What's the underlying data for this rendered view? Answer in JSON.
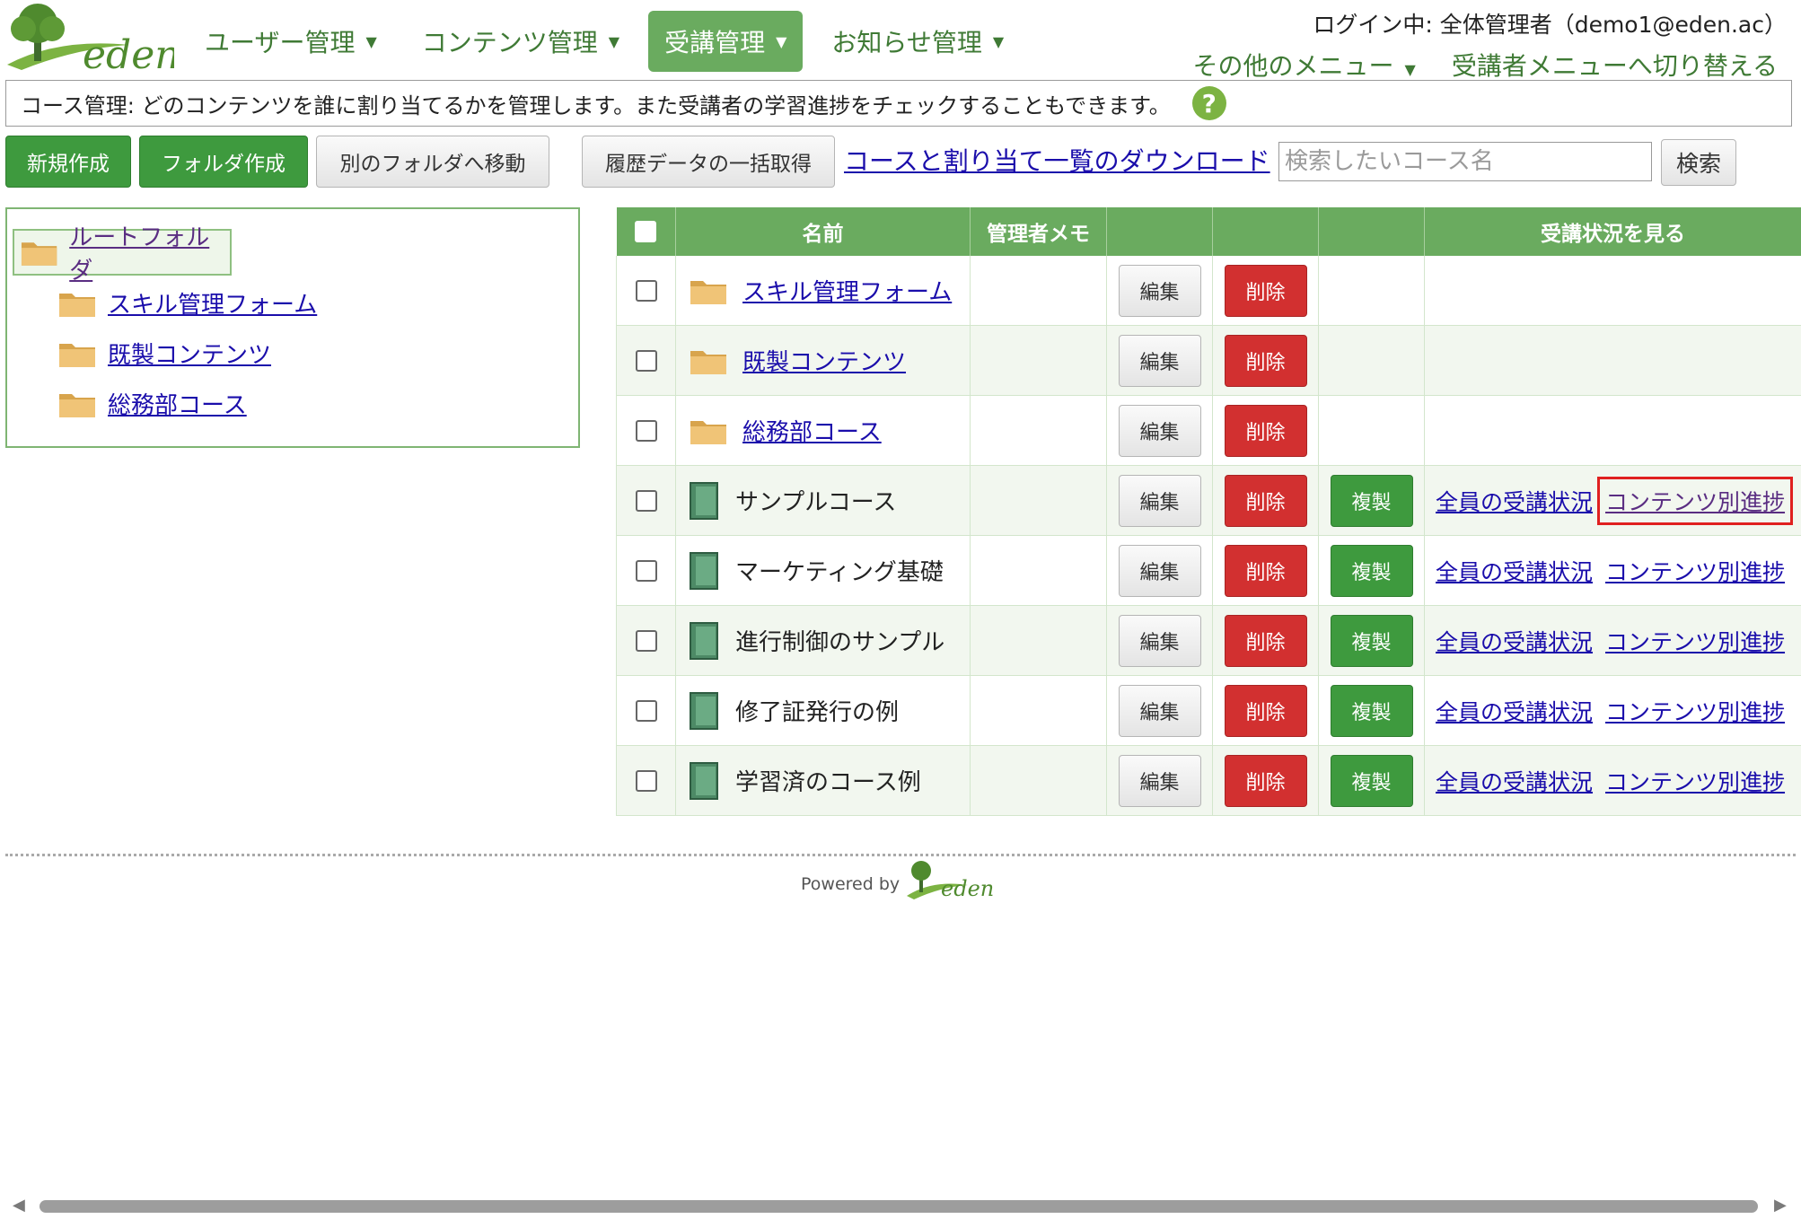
{
  "logo": {
    "text": "eden"
  },
  "nav": {
    "items": [
      {
        "label": "ユーザー管理"
      },
      {
        "label": "コンテンツ管理"
      },
      {
        "label": "受講管理"
      },
      {
        "label": "お知らせ管理"
      }
    ]
  },
  "header": {
    "login_info": "ログイン中: 全体管理者（demo1@eden.ac）",
    "other_menu": "その他のメニュー",
    "switch_menu": "受講者メニューへ切り替える"
  },
  "description": "コース管理: どのコンテンツを誰に割り当てるかを管理します。また受講者の学習進捗をチェックすることもできます。",
  "toolbar": {
    "new_label": "新規作成",
    "folder_label": "フォルダ作成",
    "move_label": "別のフォルダへ移動",
    "history_label": "履歴データの一括取得",
    "download_link": "コースと割り当て一覧のダウンロード",
    "search_placeholder": "検索したいコース名",
    "search_label": "検索"
  },
  "tree": {
    "root": "ルートフォルダ",
    "children": [
      "スキル管理フォーム",
      "既製コンテンツ",
      "総務部コース"
    ]
  },
  "table": {
    "headers": {
      "name": "名前",
      "memo": "管理者メモ",
      "status": "受講状況を見る"
    },
    "labels": {
      "edit": "編集",
      "delete": "削除",
      "copy": "複製",
      "all_status": "全員の受講状況",
      "content_progress": "コンテンツ別進捗"
    },
    "rows": [
      {
        "name": "スキル管理フォーム",
        "type": "folder"
      },
      {
        "name": "既製コンテンツ",
        "type": "folder"
      },
      {
        "name": "総務部コース",
        "type": "folder"
      },
      {
        "name": "サンプルコース",
        "type": "course"
      },
      {
        "name": "マーケティング基礎",
        "type": "course"
      },
      {
        "name": "進行制御のサンプル",
        "type": "course"
      },
      {
        "name": "修了証発行の例",
        "type": "course"
      },
      {
        "name": "学習済のコース例",
        "type": "course"
      }
    ]
  },
  "footer": {
    "powered_by": "Powered by",
    "brand": "eden"
  },
  "colors": {
    "primary_green": "#6aab5f",
    "button_green": "#3e9a3e",
    "delete_red": "#d23030",
    "link_blue": "#1a0dab"
  }
}
